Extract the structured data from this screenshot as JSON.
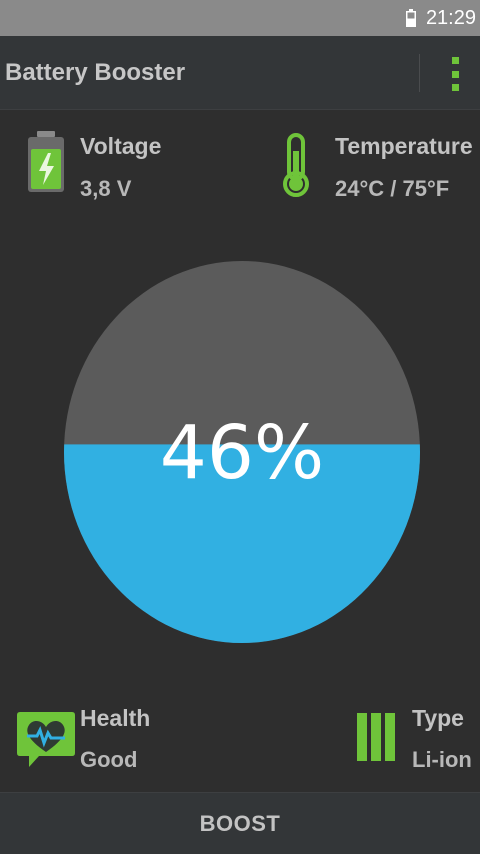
{
  "status_bar": {
    "time": "21:29",
    "icon": "battery-icon"
  },
  "app_bar": {
    "title": "Battery Booster",
    "menu_icon": "overflow-menu-icon"
  },
  "stats": {
    "voltage": {
      "label": "Voltage",
      "value": "3,8 V",
      "icon": "battery-charging-icon"
    },
    "temperature": {
      "label": "Temperature",
      "value": "24°C / 75°F",
      "icon": "thermometer-icon"
    },
    "health": {
      "label": "Health",
      "value": "Good",
      "icon": "heart-health-icon"
    },
    "type": {
      "label": "Type",
      "value": "Li-ion",
      "icon": "battery-type-icon"
    }
  },
  "gauge": {
    "percent_label": "46%",
    "level": 0.46,
    "fill_color": "#31b0e2",
    "empty_color": "#5b5b5b"
  },
  "accent_color": "#6fc43a",
  "bottom_bar": {
    "boost_label": "BOOST"
  }
}
